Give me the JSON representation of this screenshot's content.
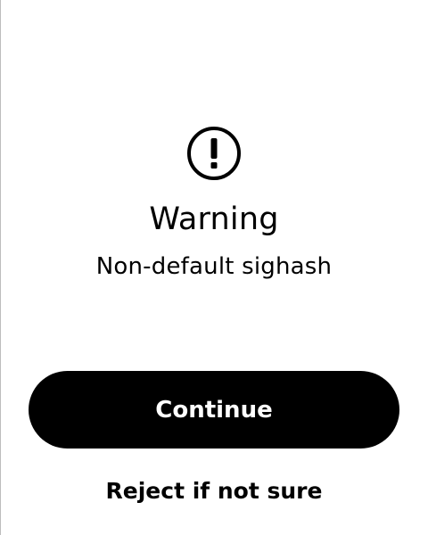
{
  "warning": {
    "icon": "exclamation-circle-icon",
    "title": "Warning",
    "message": "Non-default sighash"
  },
  "actions": {
    "continue_label": "Continue",
    "reject_label": "Reject if not sure"
  },
  "colors": {
    "background": "#ffffff",
    "foreground": "#000000",
    "button_text": "#ffffff"
  }
}
